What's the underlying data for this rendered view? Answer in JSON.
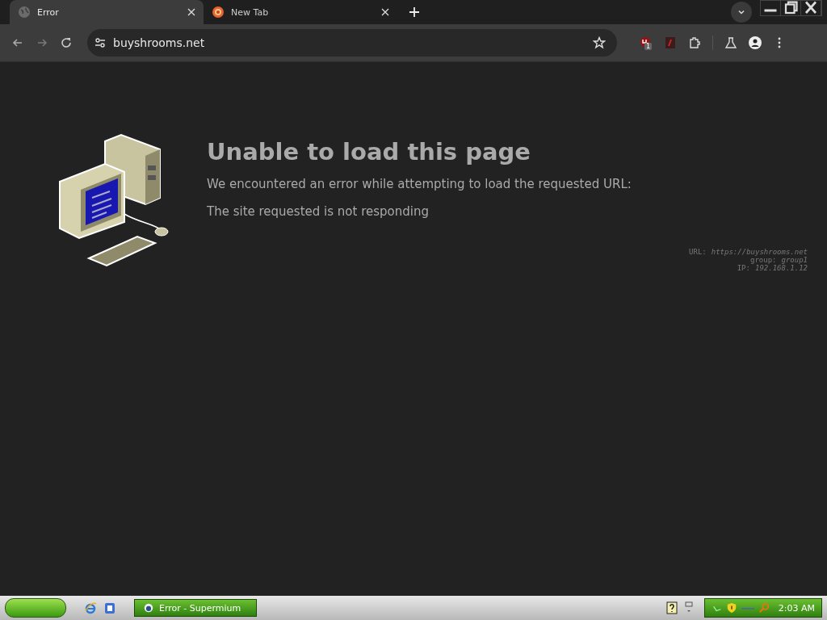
{
  "tabs": [
    {
      "title": "Error",
      "kind": "globe",
      "selected": true
    },
    {
      "title": "New Tab",
      "kind": "browser",
      "selected": false
    }
  ],
  "address": {
    "value": "buyshrooms.net"
  },
  "extension_badge": "1",
  "page": {
    "heading": "Unable to load this page",
    "message": "We encountered an error while attempting to load the requested URL:",
    "reason": "The site requested is not responding",
    "details": [
      {
        "label": "URL:",
        "value": "https://buyshrooms.net"
      },
      {
        "label": "group:",
        "value": "group1"
      },
      {
        "label": "IP:",
        "value": "192.168.1.12"
      }
    ]
  },
  "taskbar": {
    "task": "Error - Supermium",
    "clock": "2:03 AM"
  }
}
